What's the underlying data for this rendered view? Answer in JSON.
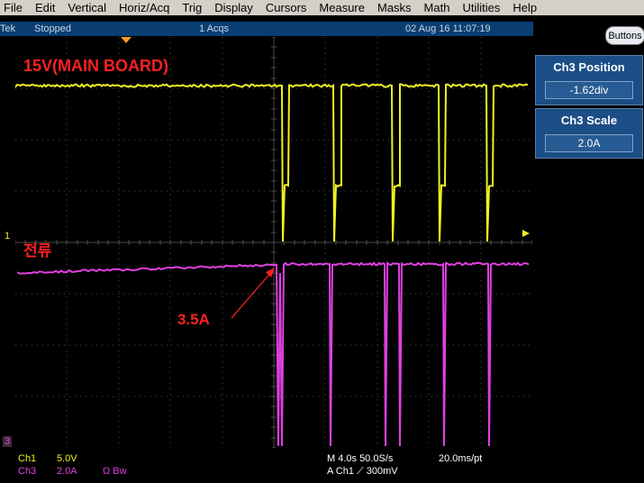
{
  "menu": [
    "File",
    "Edit",
    "Vertical",
    "Horiz/Acq",
    "Trig",
    "Display",
    "Cursors",
    "Measure",
    "Masks",
    "Math",
    "Utilities",
    "Help"
  ],
  "status": {
    "brand": "Tek",
    "run_state": "Stopped",
    "acqs": "1 Acqs",
    "datetime": "02 Aug 16 11:07:19"
  },
  "buttons_label": "Buttons",
  "readouts": {
    "position": {
      "title": "Ch3 Position",
      "value": "-1.62div"
    },
    "scale": {
      "title": "Ch3 Scale",
      "value": "2.0A"
    }
  },
  "annotations": {
    "ch1_label": "15V(MAIN BOARD)",
    "ch3_label": "전류",
    "arrow_label": "3.5A"
  },
  "markers": {
    "ch1": "1",
    "ch3": "3"
  },
  "bottom": {
    "ch1_name": "Ch1",
    "ch1_scale": "5.0V",
    "ch3_name": "Ch3",
    "ch3_scale": "2.0A",
    "ch3_flags": "Ω  Bw",
    "timebase": "M 4.0s 50.0S/s",
    "sample_interval": "20.0ms/pt",
    "trigger": "A  Ch1  ⟋  300mV"
  },
  "colors": {
    "ch1": "#f0f020",
    "ch3": "#e040e0",
    "annotation": "#ff2020",
    "grid": "#4a4a4a"
  }
}
